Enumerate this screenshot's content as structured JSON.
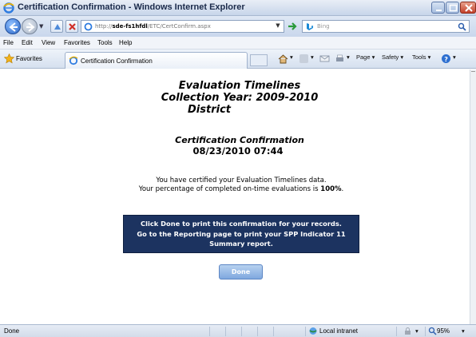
{
  "window": {
    "title": "Certification Confirmation - Windows Internet Explorer"
  },
  "address": {
    "url_prefix": "http://",
    "url_host": "sde-fs1hfdl",
    "url_path": "/ETC/CertConfirm.aspx",
    "search_placeholder": "Bing"
  },
  "menu": {
    "items": [
      "File",
      "Edit",
      "View",
      "Favorites",
      "Tools",
      "Help"
    ]
  },
  "favbar": {
    "favorites_label": "Favorites",
    "tab_label": "Certification Confirmation",
    "commands": [
      "Page ▾",
      "Safety ▾",
      "Tools ▾"
    ]
  },
  "page": {
    "title_line1": "Evaluation Timelines",
    "title_line2": "Collection Year: 2009-2010",
    "title_line3": "District",
    "subtitle": "Certification Confirmation",
    "datetime": "08/23/2010 07:44",
    "msg_line1": "You have certified your Evaluation Timelines data.",
    "msg_line2_prefix": "Your percentage of completed on-time evaluations is ",
    "msg_line2_value": "100%",
    "msg_line2_suffix": ".",
    "notice_line1": "Click Done to print this confirmation for your records.",
    "notice_line2": "Go to the Reporting page to print your SPP Indicator 11",
    "notice_line3": "Summary report.",
    "done_label": "Done"
  },
  "status": {
    "text": "Done",
    "zone": "Local intranet",
    "zoom": "95%"
  },
  "colors": {
    "notice_bg": "#1c3360",
    "done_bg": "#7fa8df"
  }
}
